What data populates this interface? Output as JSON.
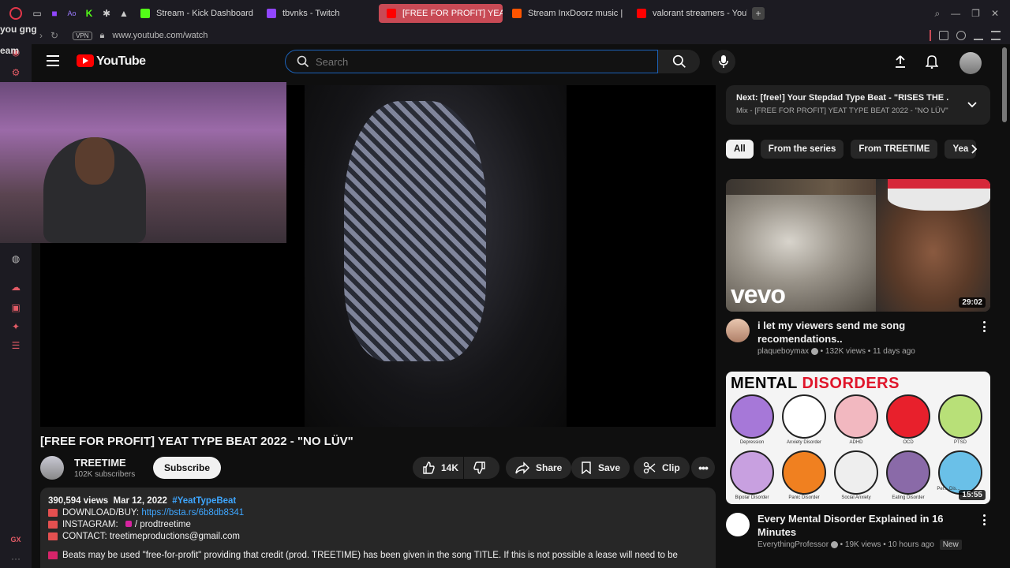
{
  "browser": {
    "tabs": [
      {
        "label": "Stream - Kick Dashboard",
        "color": "#53fc18",
        "active": false
      },
      {
        "label": "tbvnks - Twitch",
        "color": "#9146ff",
        "active": false
      },
      {
        "label": "[FREE FOR PROFIT] YEAT",
        "color": "#ff0000",
        "active": true
      },
      {
        "label": "Stream InxDoorz music |",
        "color": "#ff5500",
        "active": false
      },
      {
        "label": "valorant streamers - YouT",
        "color": "#ff0000",
        "active": false
      }
    ],
    "new_tab": "+",
    "vpn": "VPN",
    "url": "www.youtube.com/watch"
  },
  "overlay": {
    "text_top": "you gng",
    "text_second": "eam",
    "gx_label": "GX"
  },
  "youtube": {
    "logo_text": "YouTube",
    "search_placeholder": "Search"
  },
  "video": {
    "title": "[FREE FOR PROFIT] YEAT TYPE BEAT 2022 - \"NO LÜV\"",
    "channel": "TREETIME",
    "subscribers": "102K subscribers",
    "subscribe_label": "Subscribe",
    "likes": "14K",
    "share_label": "Share",
    "save_label": "Save",
    "clip_label": "Clip"
  },
  "description": {
    "views": "390,594 views",
    "date": "Mar 12, 2022",
    "hashtag": "#YeatTypeBeat",
    "download_label": "DOWNLOAD/BUY:",
    "download_url": "https://bsta.rs/6b8db8341",
    "instagram_label": "INSTAGRAM:",
    "instagram_handle": "/ prodtreetime",
    "contact_label": "CONTACT:",
    "contact_email": "treetimeproductions@gmail.com",
    "note": "Beats may be used \"free-for-profit\" providing that credit (prod. TREETIME) has been given in the song TITLE. If this is not possible a lease will need to be"
  },
  "up_next": {
    "line1": "Next: [free!] Your Stepdad Type Beat - \"RISES THE ...",
    "line2": "Mix - [FREE FOR PROFIT] YEAT TYPE BEAT 2022 - \"NO LÜV\""
  },
  "chips": [
    "All",
    "From the series",
    "From TREETIME",
    "Yea"
  ],
  "recommendations": [
    {
      "title": "i let my viewers send me song recomendations..",
      "channel": "plaqueboymax",
      "views": "132K views",
      "age": "11 days ago",
      "duration": "29:02",
      "thumb_text": "vevo"
    },
    {
      "title": "Every Mental Disorder Explained in 16 Minutes",
      "channel": "EverythingProfessor",
      "views": "19K views",
      "age": "10 hours ago",
      "badge": "New",
      "duration": "15:55",
      "thumb_title_a": "MENTAL",
      "thumb_title_b": "DISORDERS",
      "thumb_labels": [
        "Depression",
        "Anxiety Disorder",
        "ADHD",
        "OCD",
        "PTSD",
        "Bipolar Disorder",
        "Panic Disorder",
        "Social Anxiety",
        "Eating Disorder",
        "Per... Dis..."
      ]
    }
  ]
}
